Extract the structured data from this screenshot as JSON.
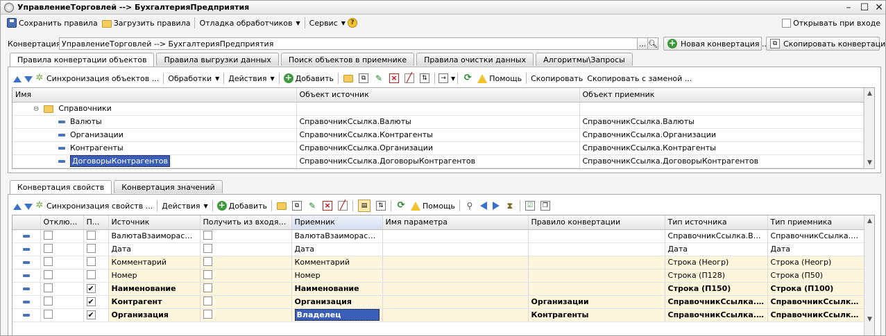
{
  "window": {
    "title": "УправлениеТорговлей --> БухгалтерияПредприятия"
  },
  "toolbar": {
    "save": "Сохранить правила",
    "load": "Загрузить правила",
    "debug": "Отладка обработчиков",
    "service": "Сервис",
    "open_on_start": "Открывать при входе"
  },
  "conversion": {
    "label": "Конвертация:",
    "value": "УправлениеТорговлей --> БухгалтерияПредприятия",
    "dots": "...",
    "new_btn": "Новая конвертация ...",
    "copy_btn": "Скопировать конвертацию"
  },
  "top_tabs": [
    "Правила конвертации объектов",
    "Правила выгрузки данных",
    "Поиск объектов в приемнике",
    "Правила очистки данных",
    "Алгоритмы\\Запросы"
  ],
  "objects_toolbar": {
    "sync": "Синхронизация объектов ...",
    "processing": "Обработки",
    "actions": "Действия",
    "add": "Добавить",
    "help": "Помощь",
    "copy": "Скопировать",
    "copy_replace": "Скопировать с заменой ..."
  },
  "objects_grid": {
    "headers": [
      "Имя",
      "Объект источник",
      "Объект приемник"
    ],
    "group": "Справочники",
    "rows": [
      {
        "name": "Валюты",
        "src": "СправочникСсылка.Валюты",
        "dst": "СправочникСсылка.Валюты"
      },
      {
        "name": "Организации",
        "src": "СправочникСсылка.Контрагенты",
        "dst": "СправочникСсылка.Организации"
      },
      {
        "name": "Контрагенты",
        "src": "СправочникСсылка.Организации",
        "dst": "СправочникСсылка.Контрагенты"
      },
      {
        "name": "ДоговорыКонтрагентов",
        "src": "СправочникСсылка.ДоговорыКонтрагентов",
        "dst": "СправочникСсылка.ДоговорыКонтрагентов"
      }
    ]
  },
  "bottom_tabs": [
    "Конвертация свойств",
    "Конвертация значений"
  ],
  "props_toolbar": {
    "sync": "Синхронизация свойств ...",
    "actions": "Действия",
    "add": "Добавить",
    "help": "Помощь"
  },
  "props_grid": {
    "headers": [
      "Отключи...",
      "П...",
      "Источник",
      "Получить из входящих ...",
      "Приемник",
      "Имя параметра",
      "Правило конвертации",
      "Тип источника",
      "Тип приемника"
    ],
    "rows": [
      {
        "p": false,
        "src": "ВалютаВзаиморасчет...",
        "dst": "ВалютаВзаиморасчет...",
        "param": "",
        "rule": "",
        "tsrc": "СправочникСсылка.Валют...",
        "tdst": "СправочникСсылка.Вал...",
        "bold": false,
        "hl": false
      },
      {
        "p": false,
        "src": "Дата",
        "dst": "Дата",
        "param": "",
        "rule": "",
        "tsrc": "Дата",
        "tdst": "Дата",
        "bold": false,
        "hl": false
      },
      {
        "p": false,
        "src": "Комментарий",
        "dst": "Комментарий",
        "param": "",
        "rule": "",
        "tsrc": "Строка (Неогр)",
        "tdst": "Строка (Неогр)",
        "bold": false,
        "hl": true
      },
      {
        "p": false,
        "src": "Номер",
        "dst": "Номер",
        "param": "",
        "rule": "",
        "tsrc": "Строка (П128)",
        "tdst": "Строка (П50)",
        "bold": false,
        "hl": true
      },
      {
        "p": true,
        "src": "Наименование",
        "dst": "Наименование",
        "param": "",
        "rule": "",
        "tsrc": "Строка (П150)",
        "tdst": "Строка (П100)",
        "bold": true,
        "hl": true
      },
      {
        "p": true,
        "src": "Контрагент",
        "dst": "Организация",
        "param": "",
        "rule": "Организации",
        "tsrc": "СправочникСсылка.К...",
        "tdst": "СправочникСсылка....",
        "bold": true,
        "hl": true
      },
      {
        "p": true,
        "src": "Организация",
        "dst": "Владелец",
        "param": "",
        "rule": "Контрагенты",
        "tsrc": "СправочникСсылка.О...",
        "tdst": "СправочникСсылка....",
        "bold": true,
        "hl": true
      }
    ]
  }
}
